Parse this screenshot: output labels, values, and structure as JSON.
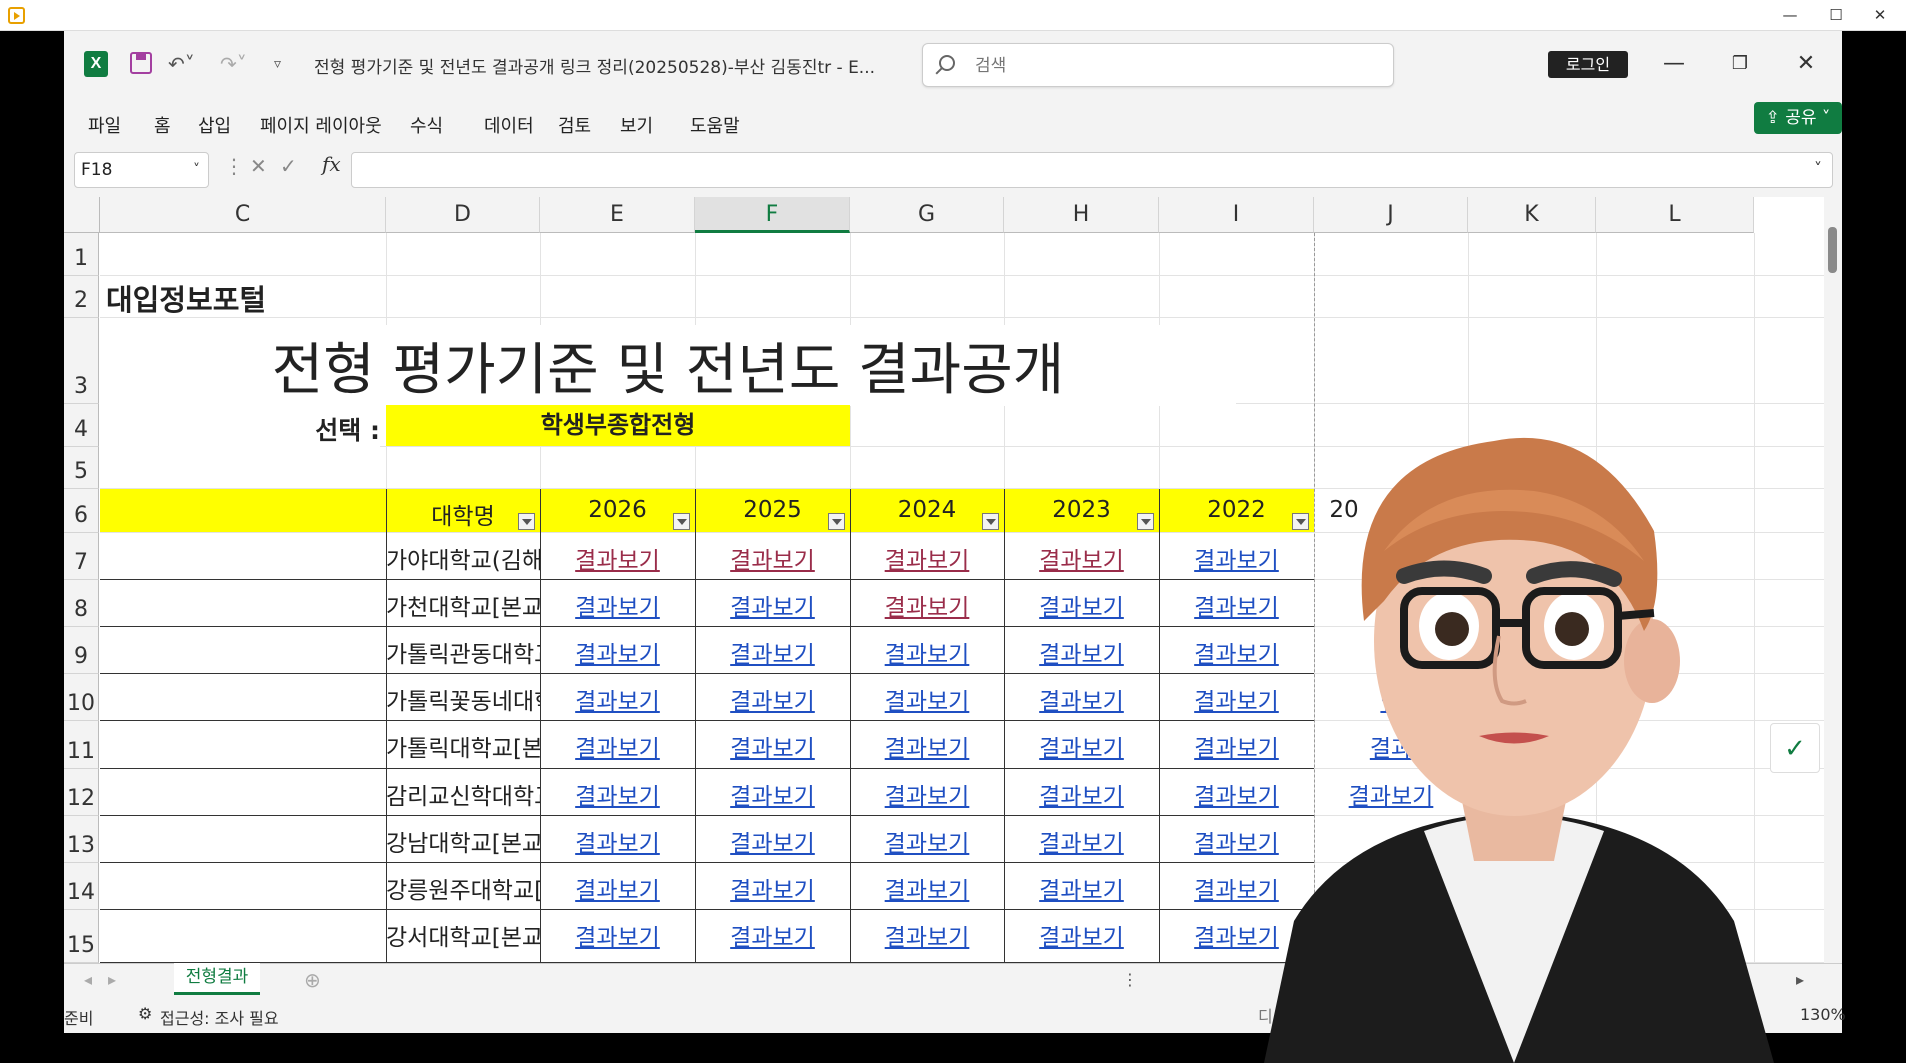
{
  "title_bar": {
    "doc_title": "전형 평가기준 및 전년도 결과공개 링크 정리(20250528)-부산 김동진tr  -  E...",
    "search_placeholder": "검색",
    "login": "로그인"
  },
  "menu": [
    "파일",
    "홈",
    "삽입",
    "페이지 레이아웃",
    "수식",
    "데이터",
    "검토",
    "보기",
    "도움말"
  ],
  "share": "공유",
  "name_box": "F18",
  "fx": "fx",
  "columns": [
    "C",
    "D",
    "E",
    "F",
    "G",
    "H",
    "I",
    "J",
    "K",
    "L"
  ],
  "rows": [
    "1",
    "2",
    "3",
    "4",
    "5",
    "6",
    "7",
    "8",
    "9",
    "10",
    "11",
    "12",
    "13",
    "14",
    "15"
  ],
  "sheet": {
    "portal": "대입정보포털",
    "heading": "전형 평가기준 및 전년도 결과공개",
    "select_label": "선택 :",
    "select_value": "학생부종합전형",
    "table_headers": [
      "대학명",
      "2026",
      "2025",
      "2024",
      "2023",
      "2022",
      "20"
    ],
    "universities": [
      "가야대학교(김해)[본교]",
      "가천대학교[본교]",
      "가톨릭관동대학교[본교]",
      "가톨릭꽃동네대학교[본교]",
      "가톨릭대학교[본교]",
      "감리교신학대학교[본교]",
      "강남대학교[본교]",
      "강릉원주대학교[본교]",
      "강서대학교[본교]"
    ],
    "link_text": "결과보기",
    "i_col_visible": [
      "결과",
      "결",
      "결",
      "결",
      "결과",
      "결과보기",
      "",
      "",
      ""
    ],
    "visited": [
      [
        1,
        1,
        1,
        1,
        0
      ],
      [
        0,
        0,
        1,
        0,
        0
      ],
      [
        0,
        0,
        0,
        0,
        0
      ],
      [
        0,
        0,
        0,
        0,
        0
      ],
      [
        0,
        0,
        0,
        0,
        0
      ],
      [
        0,
        0,
        0,
        0,
        0
      ],
      [
        0,
        0,
        0,
        0,
        0
      ],
      [
        0,
        0,
        0,
        0,
        0
      ],
      [
        0,
        0,
        0,
        0,
        0
      ]
    ]
  },
  "sheet_tab": "전형결과",
  "status": {
    "ready": "준비",
    "accessibility": "접근성: 조사 필요",
    "display": "디스플레이 설정",
    "zoom": "130%"
  },
  "colors": {
    "excel_green": "#107c41",
    "header_yellow": "#ffff00",
    "link_blue": "#1f4fc2",
    "visited": "#9a2d4a"
  }
}
